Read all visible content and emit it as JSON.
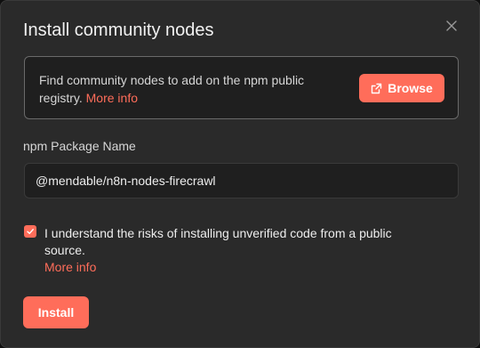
{
  "dialog": {
    "title": "Install community nodes",
    "close_icon": "close-icon"
  },
  "info": {
    "text": "Find community nodes to add on the npm public registry.",
    "link": "More info",
    "browse_label": "Browse",
    "browse_icon": "external-link-icon"
  },
  "package": {
    "label": "npm Package Name",
    "value": "@mendable/n8n-nodes-firecrawl"
  },
  "consent": {
    "checked": true,
    "text": "I understand the risks of installing unverified code from a public source.",
    "link": "More info"
  },
  "actions": {
    "install_label": "Install"
  },
  "colors": {
    "accent": "#ff6d5a",
    "background": "#2a2a2a"
  }
}
